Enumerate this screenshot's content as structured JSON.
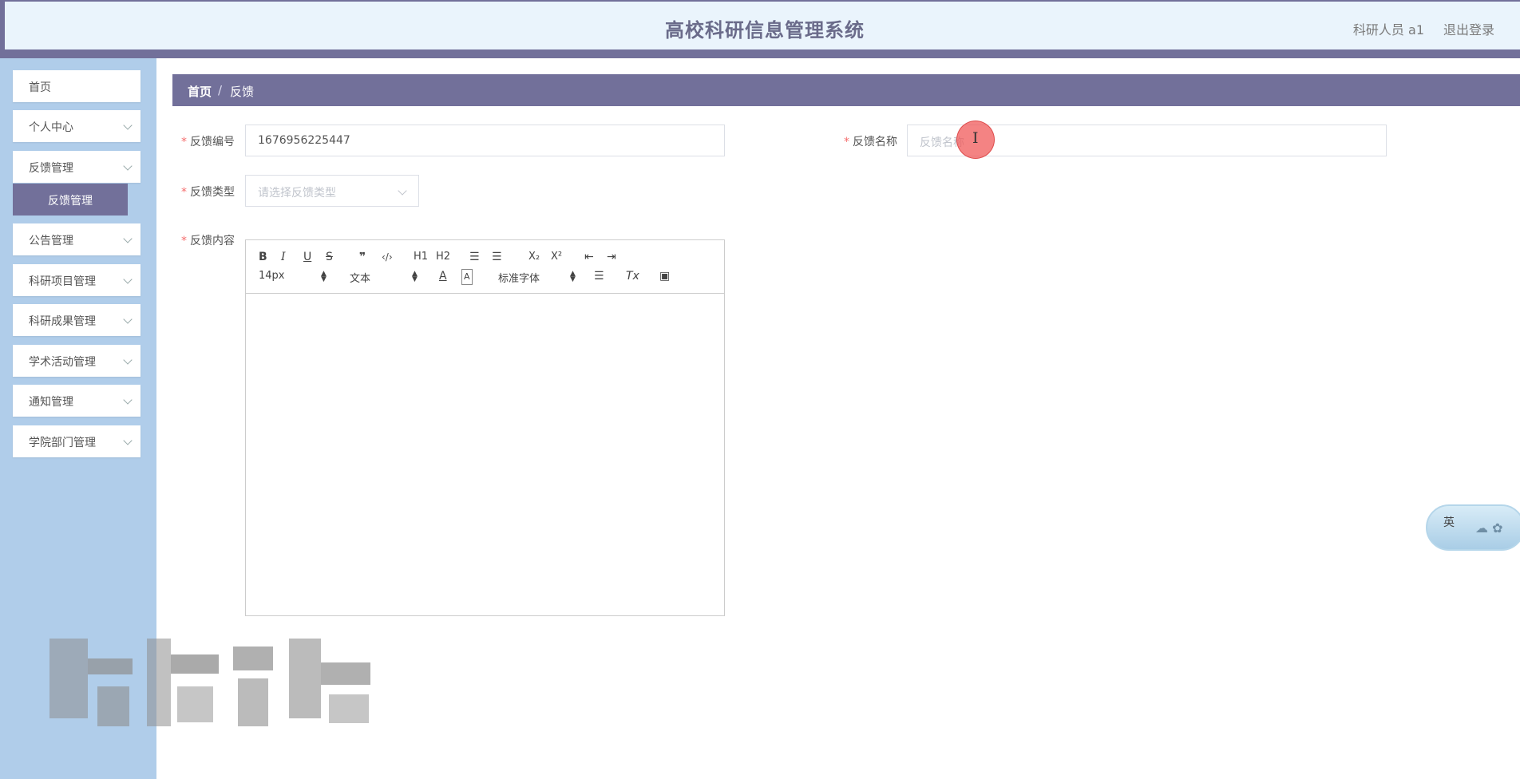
{
  "header": {
    "title": "高校科研信息管理系统",
    "user": "科研人员 a1",
    "logout": "退出登录"
  },
  "sidebar": {
    "items": [
      {
        "label": "首页"
      },
      {
        "label": "个人中心"
      },
      {
        "label": "反馈管理"
      },
      {
        "label": "公告管理"
      },
      {
        "label": "科研项目管理"
      },
      {
        "label": "科研成果管理"
      },
      {
        "label": "学术活动管理"
      },
      {
        "label": "通知管理"
      },
      {
        "label": "学院部门管理"
      }
    ],
    "submenu_active": "反馈管理"
  },
  "breadcrumb": {
    "home": "首页",
    "sep": "/",
    "current": "反馈"
  },
  "form": {
    "feedback_no": {
      "label": "反馈编号",
      "value": "1676956225447"
    },
    "feedback_name": {
      "label": "反馈名称",
      "placeholder": "反馈名称"
    },
    "feedback_type": {
      "label": "反馈类型",
      "placeholder": "请选择反馈类型"
    },
    "feedback_content": {
      "label": "反馈内容"
    }
  },
  "editor": {
    "buttons": {
      "bold": "B",
      "italic": "I",
      "underline": "U",
      "strike": "S",
      "quote": "❞",
      "code": "‹/›",
      "h1": "H1",
      "h2": "H2",
      "ol": "☰",
      "ul": "☰",
      "sub": "X₂",
      "sup": "X²",
      "outdent": "⇤",
      "indent": "⇥"
    },
    "size": "14px",
    "header_select": "文本",
    "font_select": "标准字体",
    "color_btn": "A",
    "bg_btn": "A",
    "align_btn": "☰",
    "clean_btn": "Tx",
    "image_btn": "▣"
  },
  "ime_widget": {
    "text": "英"
  }
}
